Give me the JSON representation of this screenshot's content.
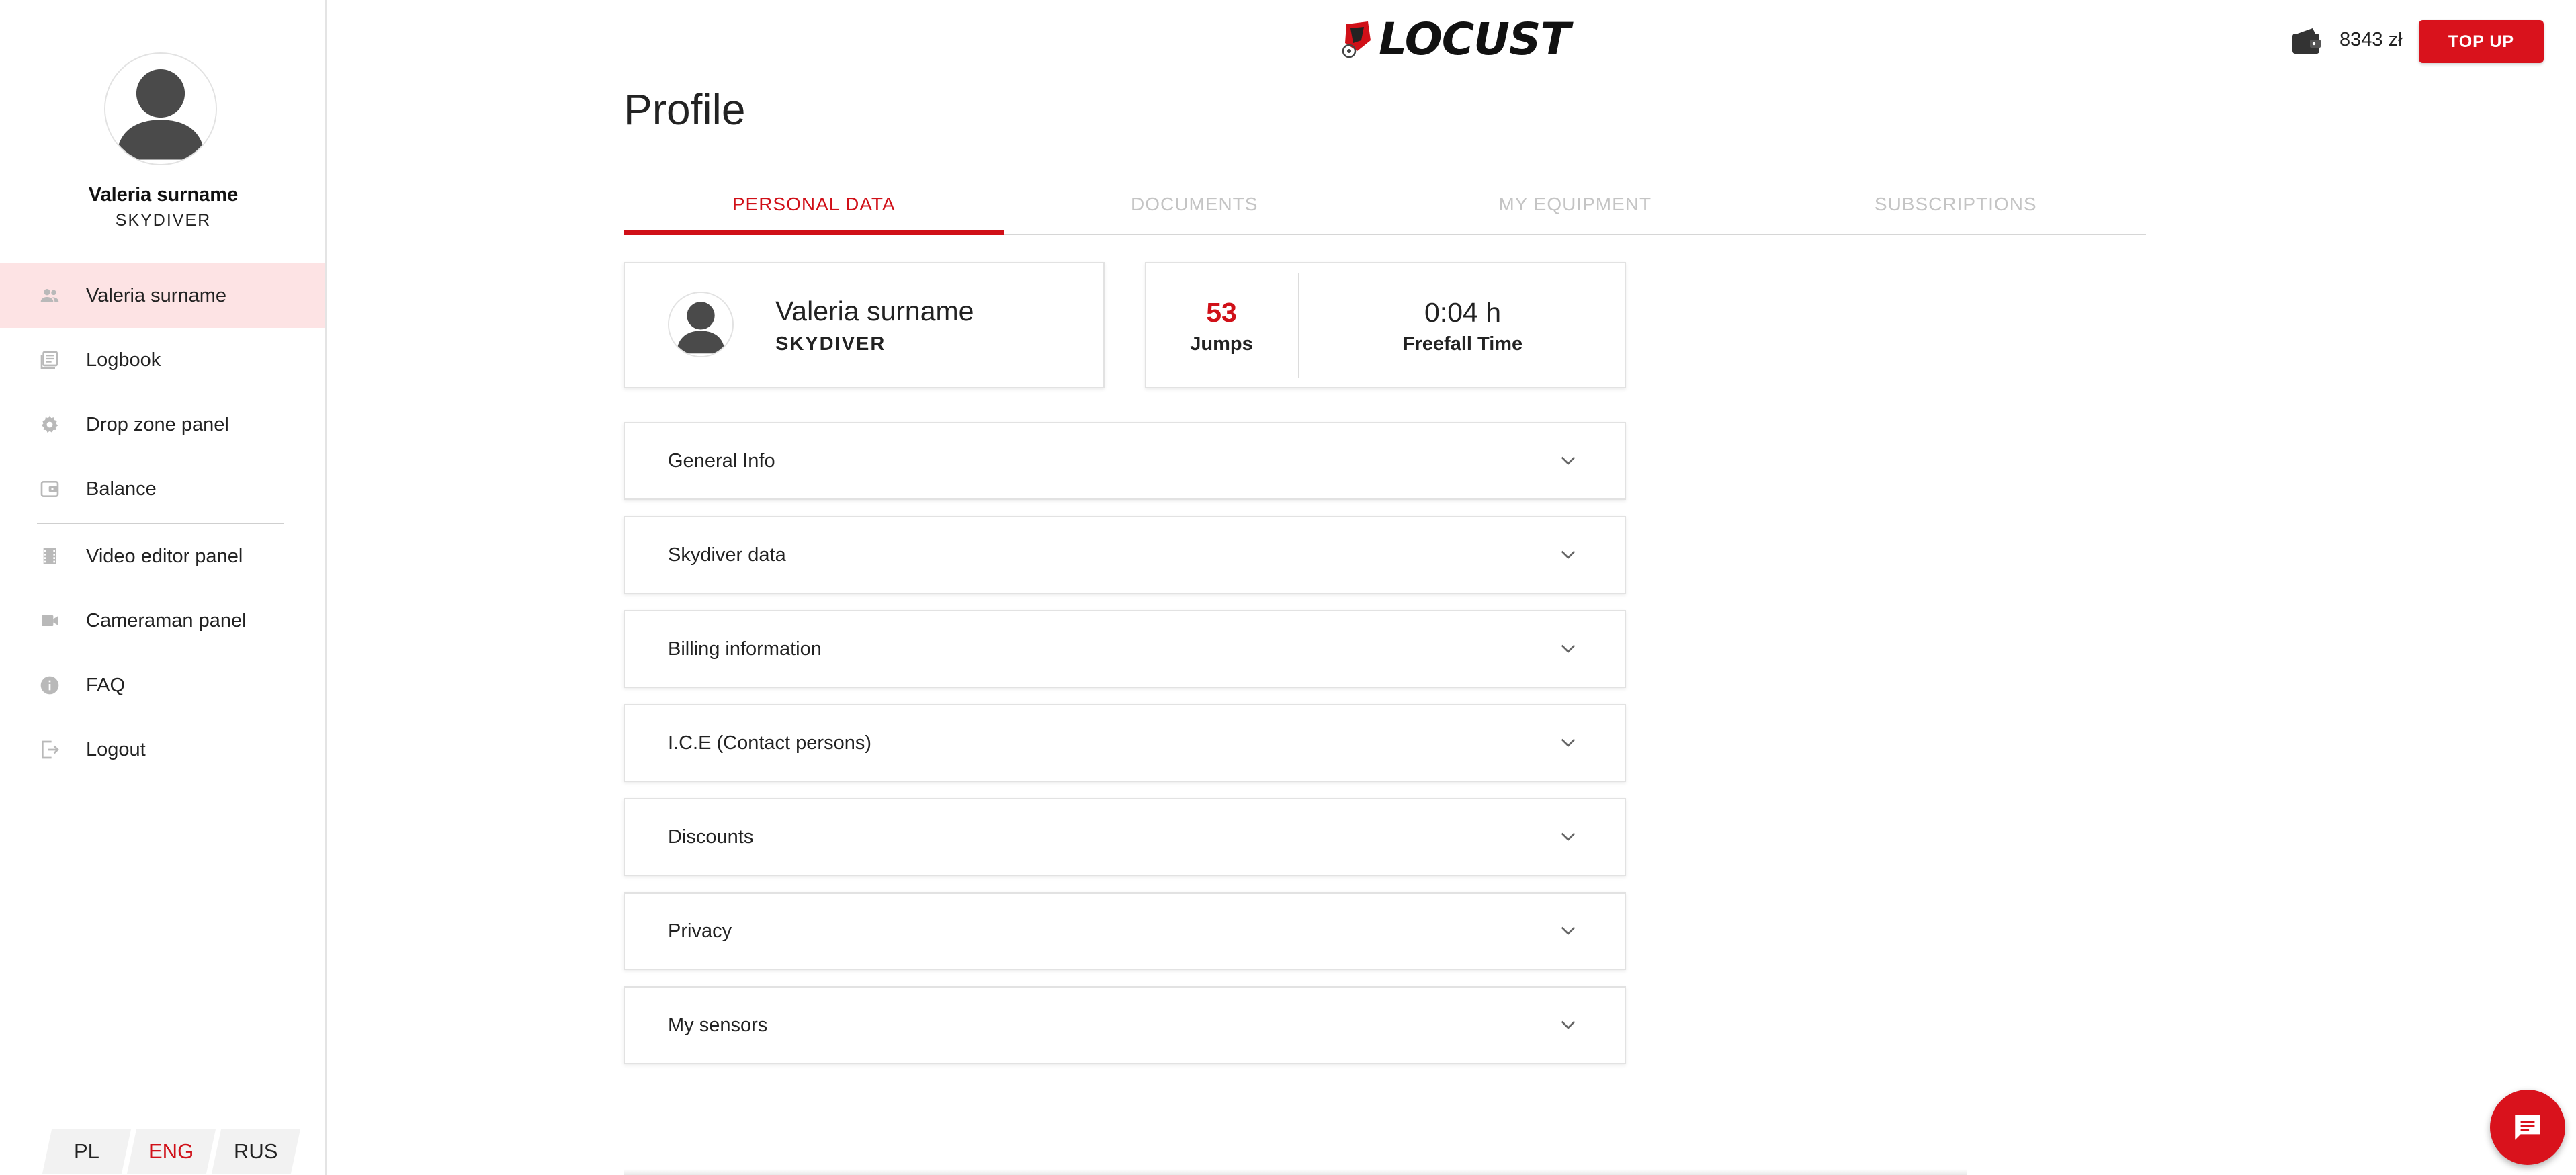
{
  "sidebar": {
    "user_name": "Valeria surname",
    "user_role": "SKYDIVER",
    "items": [
      {
        "label": "Valeria surname",
        "icon": "people-icon",
        "active": true
      },
      {
        "label": "Logbook",
        "icon": "logbook-icon"
      },
      {
        "label": "Drop zone panel",
        "icon": "gear-icon"
      },
      {
        "label": "Balance",
        "icon": "wallet-icon"
      },
      {
        "label": "Video editor panel",
        "icon": "film-icon"
      },
      {
        "label": "Cameraman panel",
        "icon": "videocam-icon"
      },
      {
        "label": "FAQ",
        "icon": "info-icon"
      },
      {
        "label": "Logout",
        "icon": "logout-icon"
      }
    ],
    "languages": [
      {
        "label": "PL"
      },
      {
        "label": "ENG",
        "active": true
      },
      {
        "label": "RUS"
      }
    ]
  },
  "header": {
    "logo_text": "LOCUST",
    "balance": "8343 zł",
    "topup_label": "TOP UP"
  },
  "page": {
    "title": "Profile"
  },
  "tabs": [
    {
      "label": "PERSONAL DATA",
      "active": true
    },
    {
      "label": "DOCUMENTS"
    },
    {
      "label": "MY EQUIPMENT"
    },
    {
      "label": "SUBSCRIPTIONS"
    }
  ],
  "profile_card": {
    "name": "Valeria surname",
    "role": "SKYDIVER"
  },
  "stats": {
    "jumps_value": "53",
    "jumps_label": "Jumps",
    "freefall_value": "0:04 h",
    "freefall_label": "Freefall Time"
  },
  "sections": [
    {
      "title": "General Info"
    },
    {
      "title": "Skydiver data"
    },
    {
      "title": "Billing information"
    },
    {
      "title": "I.C.E (Contact persons)"
    },
    {
      "title": "Discounts"
    },
    {
      "title": "Privacy"
    },
    {
      "title": "My sensors"
    }
  ],
  "colors": {
    "accent": "#d01018",
    "active_nav_bg": "#fde3e4"
  }
}
